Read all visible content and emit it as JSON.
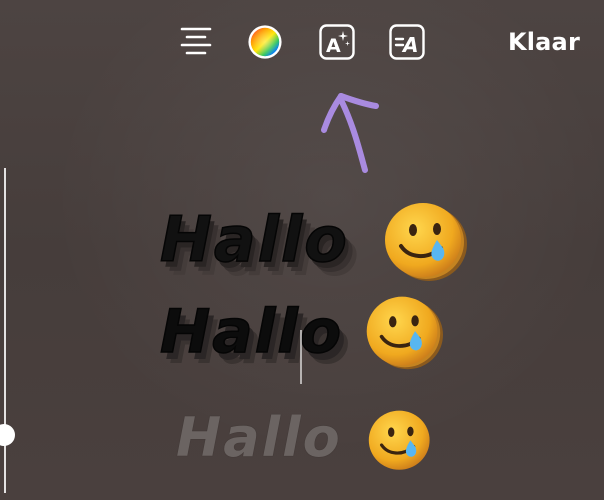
{
  "toolbar": {
    "icons": {
      "align": "text-align-lines-icon",
      "color": "color-wheel-icon",
      "effects": "text-effects-sparkle-icon",
      "style": "text-style-icon"
    },
    "effects_glyph": "A",
    "style_glyph": "A",
    "done_label": "Klaar"
  },
  "canvas": {
    "lines": [
      {
        "text": "Hallo",
        "emoji": "smiling-face-with-tear-icon"
      },
      {
        "text": "Hallo",
        "emoji": "smiling-face-with-tear-icon"
      },
      {
        "text": "Hallo",
        "emoji": "smiling-face-with-tear-icon"
      }
    ]
  },
  "colors": {
    "background": "#4b4240",
    "annotation_arrow": "#a98be0",
    "text_primary": "#ffffff"
  }
}
